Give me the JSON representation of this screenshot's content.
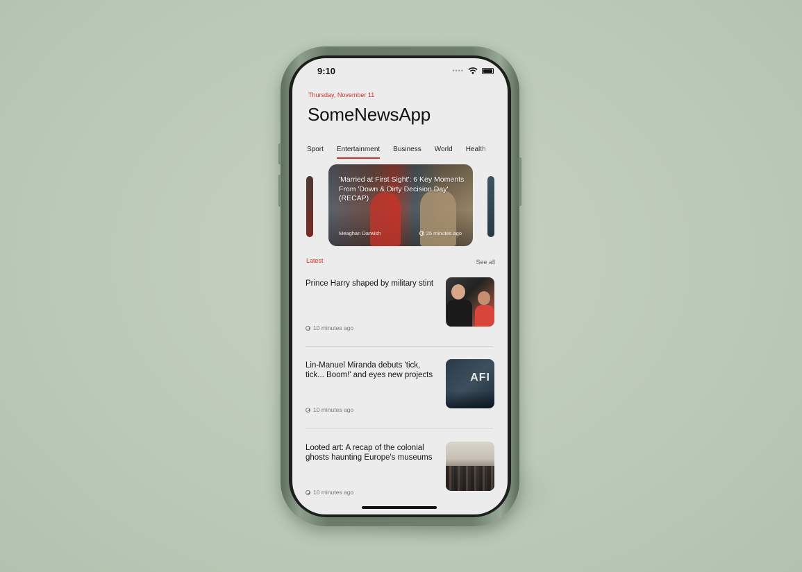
{
  "status_bar": {
    "time": "9:10",
    "signal_dots": "••••"
  },
  "header": {
    "date": "Thursday, November 11",
    "app_title": "SomeNewsApp"
  },
  "tabs": [
    {
      "label": "Sport",
      "active": false
    },
    {
      "label": "Entertainment",
      "active": true
    },
    {
      "label": "Business",
      "active": false
    },
    {
      "label": "World",
      "active": false
    },
    {
      "label": "Health",
      "active": false
    }
  ],
  "featured": {
    "title": "'Married at First Sight': 6 Key Moments From 'Down & Dirty Decision Day' (RECAP)",
    "author": "Meaghan Darwish",
    "time": "25 minutes ago"
  },
  "latest": {
    "label": "Latest",
    "see_all": "See all",
    "articles": [
      {
        "title": "Prince Harry shaped by military stint",
        "time": "10 minutes ago"
      },
      {
        "title": "Lin-Manuel Miranda debuts 'tick, tick... Boom!' and eyes new projects",
        "time": "10 minutes ago"
      },
      {
        "title": "Looted art: A recap of the colonial ghosts haunting Europe's museums",
        "time": "10 minutes ago"
      }
    ],
    "thumb_text_2": "AFI"
  },
  "colors": {
    "accent": "#d0322a",
    "background": "#bfcbbb",
    "phone_frame": "#6f7f6e",
    "screen": "#ececec"
  }
}
